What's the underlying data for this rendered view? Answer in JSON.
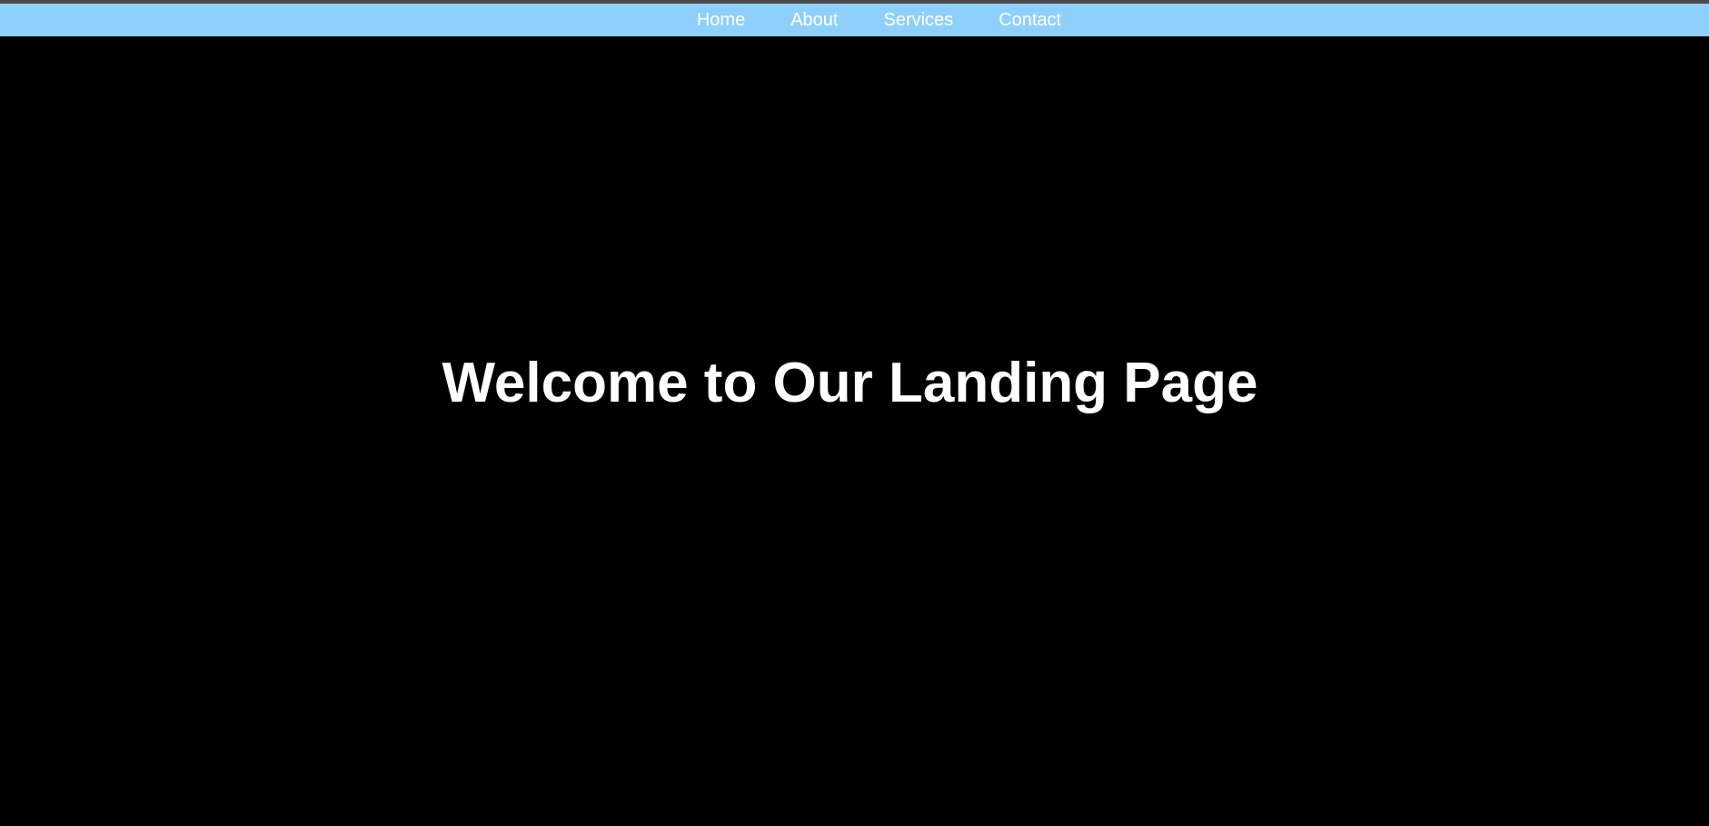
{
  "colors": {
    "nav_background": "#8ed0fb",
    "nav_text": "#ffffff",
    "hero_background": "#000000",
    "hero_text": "#ffffff",
    "top_border": "#4a4a4a"
  },
  "nav": {
    "items": [
      {
        "label": "Home"
      },
      {
        "label": "About"
      },
      {
        "label": "Services"
      },
      {
        "label": "Contact"
      }
    ]
  },
  "hero": {
    "title": "Welcome to Our Landing Page"
  }
}
